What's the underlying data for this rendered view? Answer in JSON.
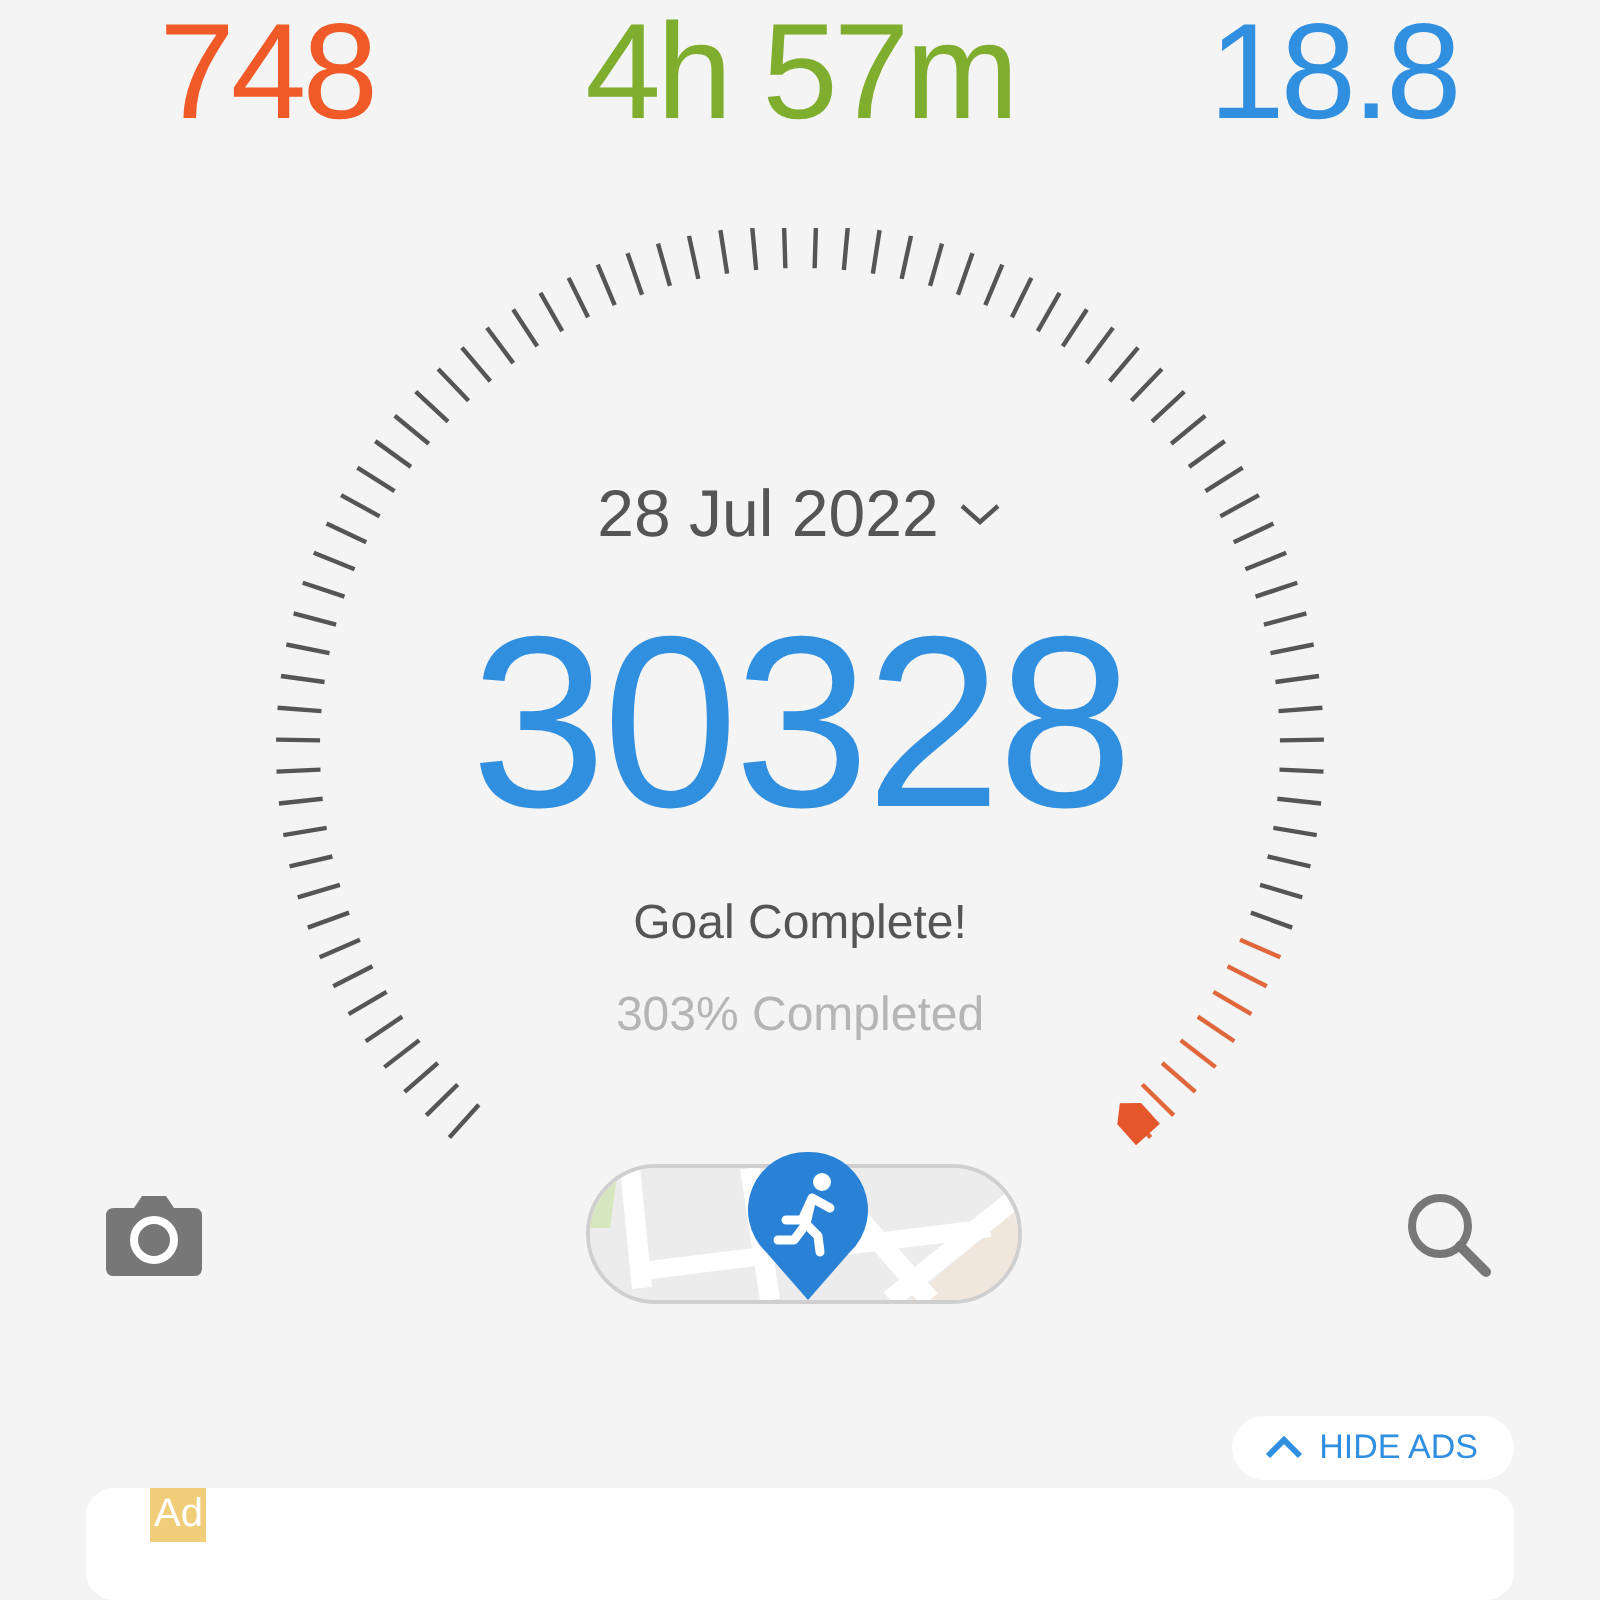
{
  "stats": [
    {
      "value": "748",
      "color": "#ef5a28"
    },
    {
      "value": "4h 57m",
      "color": "#7fae2e"
    },
    {
      "value": "18.8",
      "color": "#318fe0"
    }
  ],
  "gauge": {
    "date": "28 Jul 2022",
    "steps": "30328",
    "status": "Goal Complete!",
    "percent": "303% Completed"
  },
  "hide_ads": {
    "label": "HIDE ADS"
  },
  "ad": {
    "badge": "Ad"
  }
}
